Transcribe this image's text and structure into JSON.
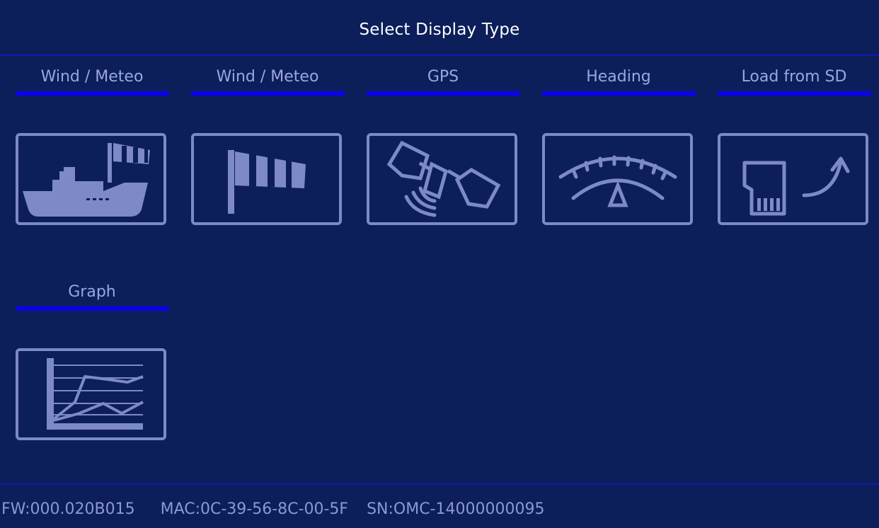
{
  "header": {
    "title": "Select Display Type"
  },
  "display_types": [
    {
      "label": "Wind / Meteo",
      "icon": "boat-windsock-icon"
    },
    {
      "label": "Wind / Meteo",
      "icon": "windsock-icon"
    },
    {
      "label": "GPS",
      "icon": "satellite-icon"
    },
    {
      "label": "Heading",
      "icon": "heading-gauge-icon"
    },
    {
      "label": "Load from SD",
      "icon": "sd-card-load-icon"
    },
    {
      "label": "Graph",
      "icon": "line-graph-icon"
    }
  ],
  "footer": {
    "fw": "FW:000.020B015",
    "mac": "MAC:0C-39-56-8C-00-5F",
    "sn": "SN:OMC-14000000095"
  },
  "colors": {
    "background": "#0c1f5a",
    "divider": "#1818b0",
    "underline": "#0a00f0",
    "icon": "#7e89c8",
    "title_text": "#ffffff",
    "label_text": "#9ca6df"
  }
}
